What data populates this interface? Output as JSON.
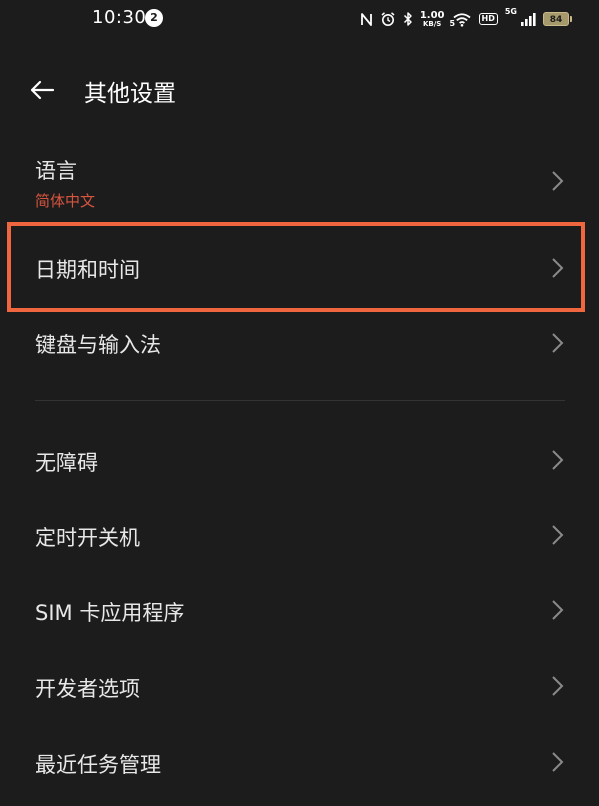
{
  "status_bar": {
    "time": "10:30",
    "notification_count": "2",
    "net_speed_value": "1.00",
    "net_speed_unit": "KB/S",
    "hd_label": "HD",
    "signal_label": "5G",
    "wifi_label": "5",
    "battery": "84"
  },
  "header": {
    "title": "其他设置"
  },
  "settings": {
    "language": {
      "label": "语言",
      "value": "简体中文"
    },
    "date_time": {
      "label": "日期和时间"
    },
    "keyboard": {
      "label": "键盘与输入法"
    },
    "accessibility": {
      "label": "无障碍"
    },
    "scheduled_power": {
      "label": "定时开关机"
    },
    "sim_apps": {
      "label": "SIM 卡应用程序"
    },
    "developer": {
      "label": "开发者选项"
    },
    "recent_tasks": {
      "label": "最近任务管理"
    }
  },
  "colors": {
    "background": "#1c1c1c",
    "accent_value": "#d8553f",
    "highlight_border": "#f0663f"
  }
}
